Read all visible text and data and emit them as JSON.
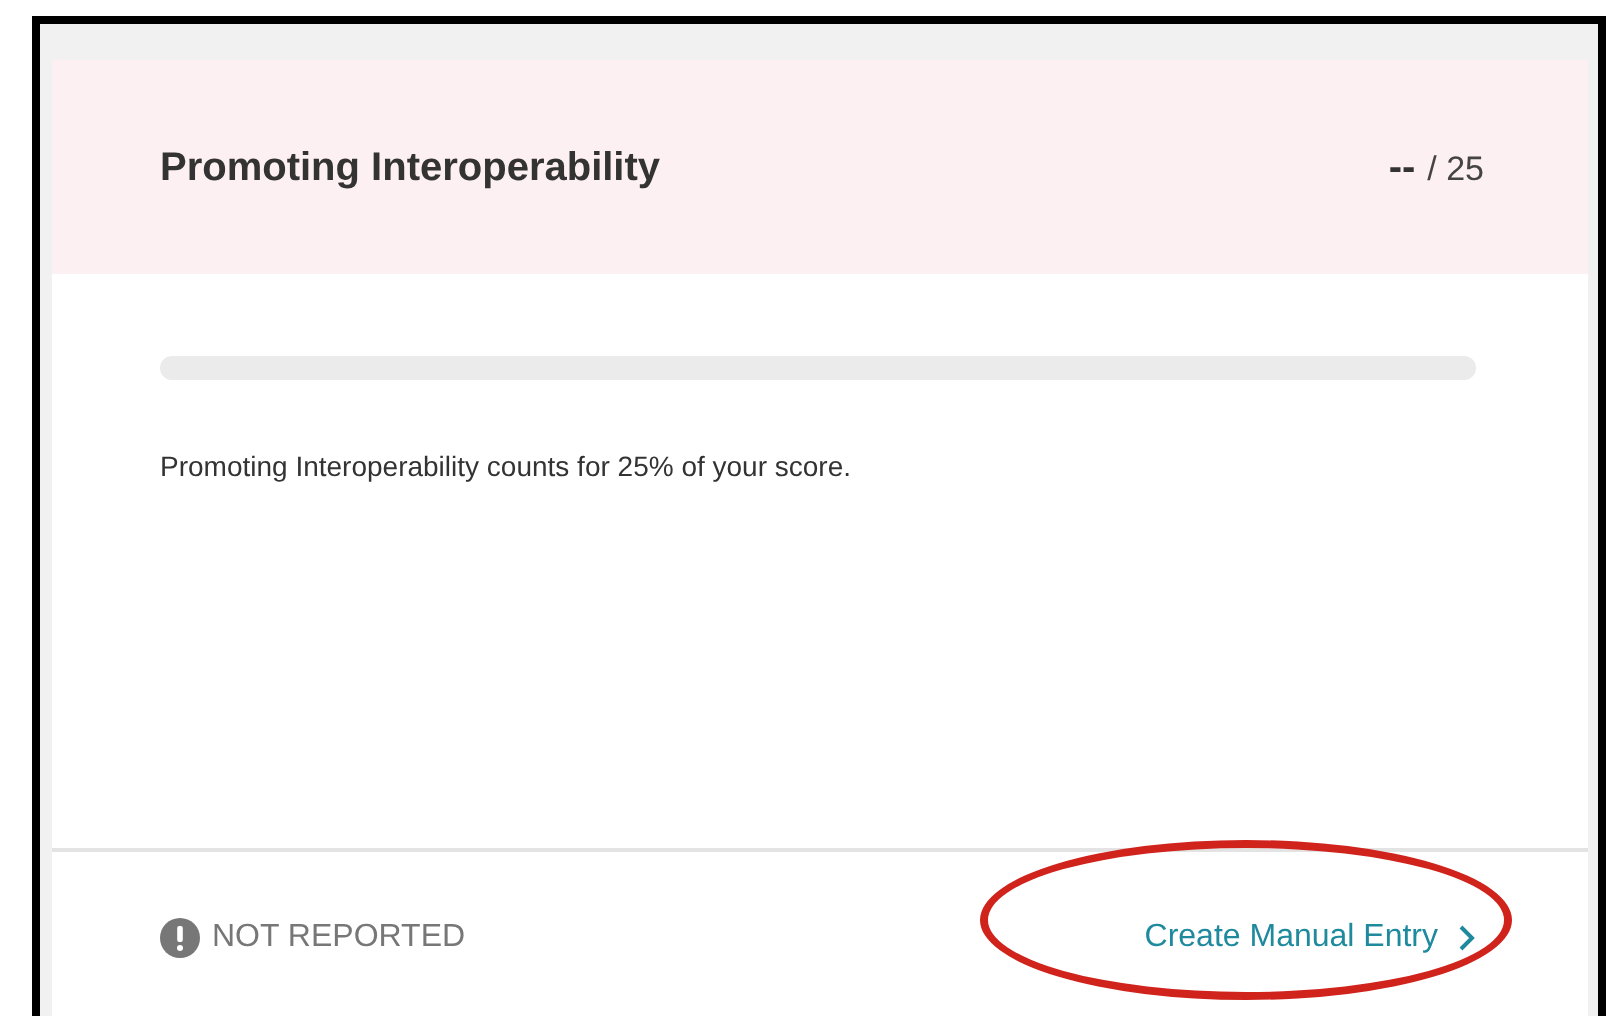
{
  "card": {
    "title": "Promoting Interoperability",
    "score": "--",
    "max": "/ 25",
    "progress": {
      "level": 0
    },
    "description": "Promoting Interoperability counts for 25% of your score.",
    "status": "NOT REPORTED",
    "link": {
      "label": "Create Manual Entry",
      "circled": true
    }
  }
}
